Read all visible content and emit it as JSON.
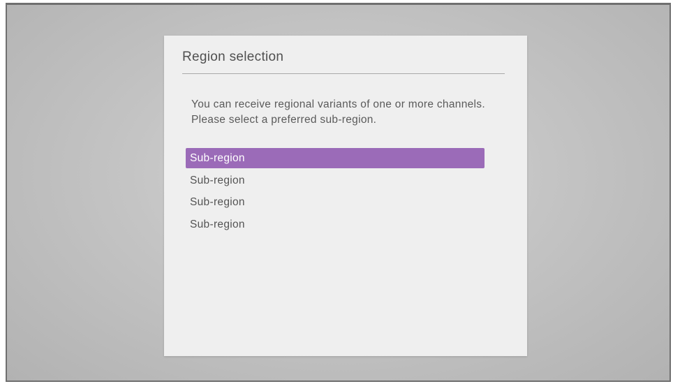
{
  "dialog": {
    "title": "Region selection",
    "description": "You can receive regional variants of one or more channels. Please select a preferred sub-region.",
    "options": [
      {
        "label": "Sub-region",
        "selected": true
      },
      {
        "label": "Sub-region",
        "selected": false
      },
      {
        "label": "Sub-region",
        "selected": false
      },
      {
        "label": "Sub-region",
        "selected": false
      }
    ]
  },
  "colors": {
    "selection_highlight": "#9b6bb8",
    "dialog_background": "#efefef",
    "screen_background": "#c4c4c4"
  }
}
